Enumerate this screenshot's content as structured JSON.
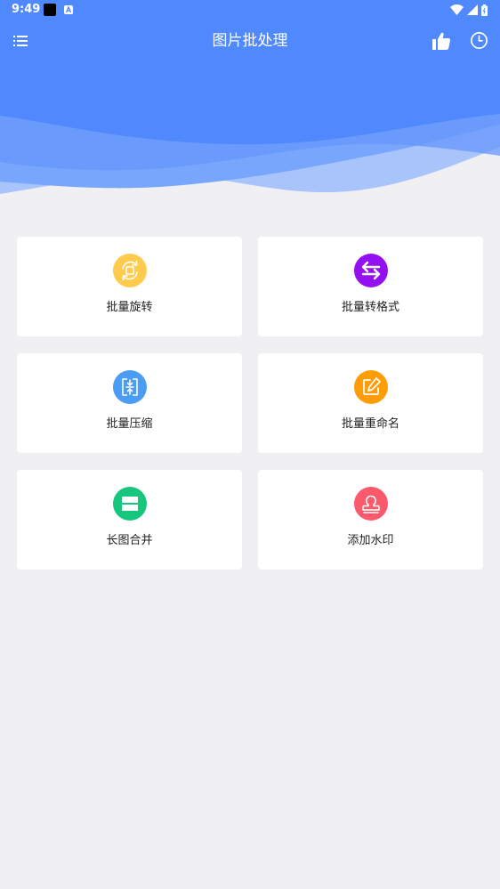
{
  "status_bar": {
    "time": "9:49"
  },
  "toolbar": {
    "title": "图片批处理"
  },
  "colors": {
    "header_blue": "#5089fd",
    "background": "#f0f0f3",
    "rotate": "#fecb4d",
    "convert": "#9410f0",
    "compress": "#4a9cf4",
    "rename": "#fe9d07",
    "merge": "#16c67c",
    "watermark": "#fb5a6c"
  },
  "features": [
    {
      "label": "批量旋转",
      "icon": "rotate-icon"
    },
    {
      "label": "批量转格式",
      "icon": "swap-icon"
    },
    {
      "label": "批量压缩",
      "icon": "compress-icon"
    },
    {
      "label": "批量重命名",
      "icon": "edit-icon"
    },
    {
      "label": "长图合并",
      "icon": "merge-icon"
    },
    {
      "label": "添加水印",
      "icon": "stamp-icon"
    }
  ]
}
